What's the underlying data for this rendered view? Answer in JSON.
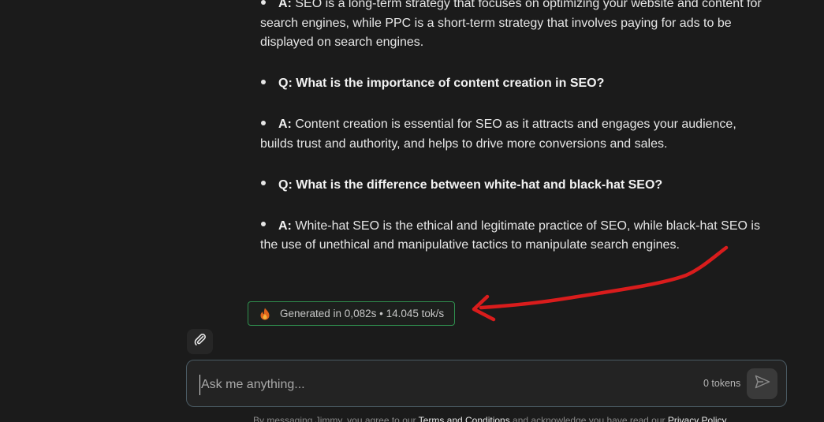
{
  "qa_items": [
    {
      "type": "answer",
      "tag": "A:",
      "text": "SEO is a long-term strategy that focuses on optimizing your website and content for search engines, while PPC is a short-term strategy that involves paying for ads to be displayed on search engines."
    },
    {
      "type": "question",
      "tag": "Q:",
      "text": "What is the importance of content creation in SEO?"
    },
    {
      "type": "answer",
      "tag": "A:",
      "text": "Content creation is essential for SEO as it attracts and engages your audience, builds trust and authority, and helps to drive more conversions and sales."
    },
    {
      "type": "question",
      "tag": "Q:",
      "text": "What is the difference between white-hat and black-hat SEO?"
    },
    {
      "type": "answer",
      "tag": "A:",
      "text": "White-hat SEO is the ethical and legitimate practice of SEO, while black-hat SEO is the use of unethical and manipulative tactics to manipulate search engines."
    }
  ],
  "generation_badge": {
    "text": "Generated in 0,082s • 14.045 tok/s",
    "icon": "fire-icon"
  },
  "composer": {
    "placeholder": "Ask me anything...",
    "token_count": "0 tokens",
    "attach_icon": "paperclip-icon",
    "send_icon": "send-icon"
  },
  "footer": {
    "prefix": "By messaging Jimmy, you agree to our ",
    "terms_link": "Terms and Conditions",
    "middle": " and acknowledge you have read our ",
    "privacy_link": "Privacy Policy"
  },
  "colors": {
    "background": "#1b1b1b",
    "badge_border": "#2f8f4e",
    "input_border": "#4a5a63",
    "annotation_arrow": "#d91c1c"
  }
}
